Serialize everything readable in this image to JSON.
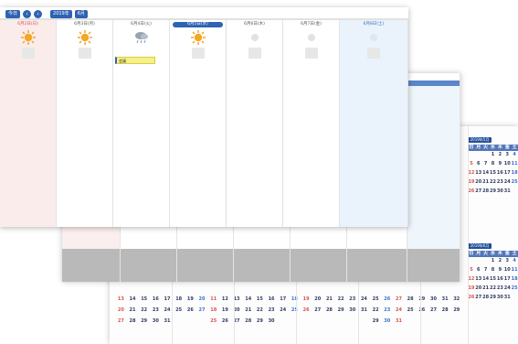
{
  "toolbar": {
    "today_label": "今日",
    "prev_label": "‹",
    "next_label": "›",
    "year_label": "2019年",
    "month_label": "6月"
  },
  "week": {
    "days": [
      {
        "label": "6月2日(日)",
        "kind": "sun",
        "weather": "sun-icon"
      },
      {
        "label": "6月3日(月)",
        "kind": "normal",
        "weather": "sun-icon"
      },
      {
        "label": "6月4日(火)",
        "kind": "normal",
        "weather": "cloud-rain-icon"
      },
      {
        "label": "6月5日(水)",
        "kind": "today",
        "weather": "sun-icon"
      },
      {
        "label": "6月6日(木)",
        "kind": "normal",
        "weather": "faded-icon"
      },
      {
        "label": "6月7日(金)",
        "kind": "normal",
        "weather": "faded-icon"
      },
      {
        "label": "6月8日(土)",
        "kind": "sat",
        "weather": "faded-icon"
      }
    ],
    "event_text": "会議"
  },
  "year": {
    "month_titles": [
      "2019年5月",
      "2019年6月"
    ],
    "weekday_row": [
      "日",
      "月",
      "火",
      "水",
      "木",
      "金",
      "土"
    ],
    "rows_a": [
      [
        "",
        "",
        "",
        "1",
        "2",
        "3",
        "4"
      ],
      [
        "5",
        "6",
        "7",
        "8",
        "9",
        "10",
        "11"
      ],
      [
        "12",
        "13",
        "14",
        "15",
        "16",
        "17",
        "18"
      ],
      [
        "19",
        "20",
        "21",
        "22",
        "23",
        "24",
        "25"
      ],
      [
        "26",
        "27",
        "28",
        "29",
        "30",
        "31",
        ""
      ]
    ],
    "bottom_rows": [
      [
        "13",
        "14",
        "15",
        "16",
        "17",
        "18",
        "19",
        "20",
        "11",
        "12",
        "13",
        "14",
        "15",
        "16",
        "17",
        "18",
        "19",
        "20",
        "21",
        "22",
        "23",
        "24",
        "25",
        "26",
        "27",
        "28",
        "29",
        "30",
        "31",
        "32"
      ],
      [
        "20",
        "21",
        "22",
        "23",
        "24",
        "25",
        "26",
        "27",
        "18",
        "19",
        "20",
        "21",
        "22",
        "23",
        "24",
        "25",
        "26",
        "27",
        "28",
        "29",
        "30",
        "31",
        "22",
        "23",
        "24",
        "25",
        "26",
        "27",
        "28",
        "29"
      ],
      [
        "27",
        "28",
        "29",
        "30",
        "31",
        "",
        "",
        "",
        "25",
        "26",
        "27",
        "28",
        "29",
        "30",
        "",
        "",
        "",
        "",
        "",
        "",
        "",
        "",
        "29",
        "30",
        "31",
        "",
        "",
        "",
        "",
        ""
      ]
    ]
  },
  "colors": {
    "brand": "#2f62b3",
    "sunday": "#d9534f",
    "saturday": "#3a6fc4",
    "weekday_bg": "#5276b8"
  }
}
